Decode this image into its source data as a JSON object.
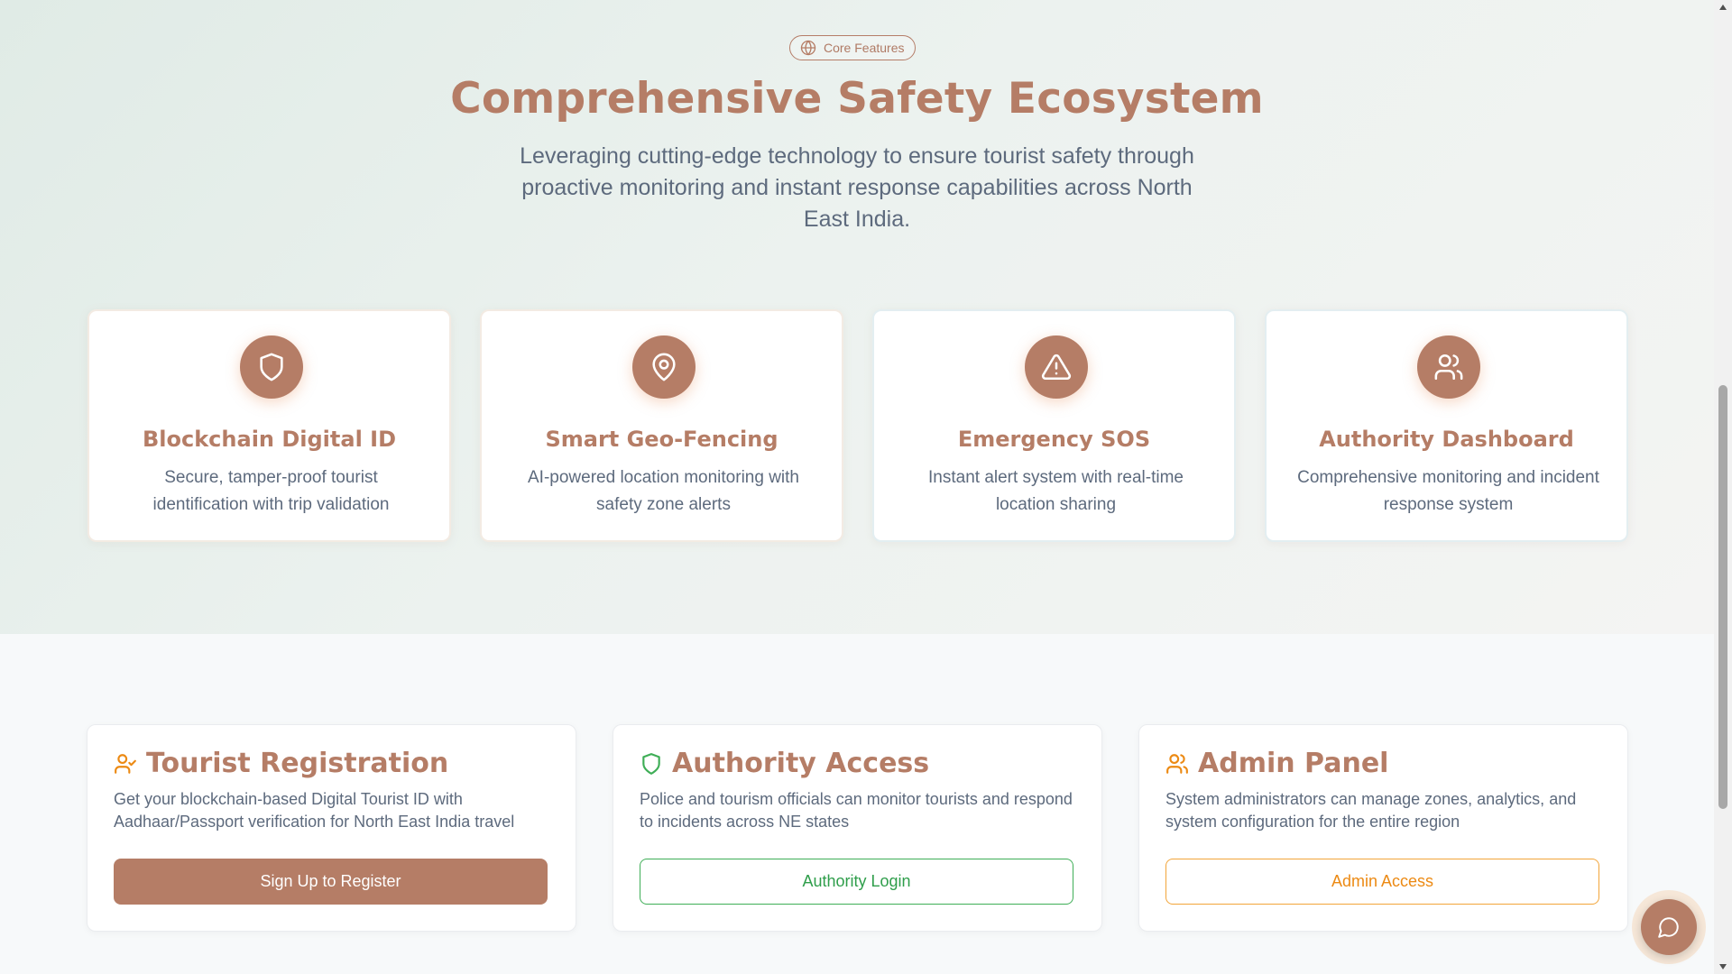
{
  "colors": {
    "brand": "#b57d66",
    "text": "#5d6a7d",
    "green": "#3fae57",
    "orange": "#ec8a14"
  },
  "features_section": {
    "badge": {
      "icon": "globe-icon",
      "label": "Core Features"
    },
    "title": "Comprehensive Safety Ecosystem",
    "subtitle": "Leveraging cutting-edge technology to ensure tourist safety through proactive monitoring and instant response capabilities across North East India.",
    "cards": [
      {
        "icon": "shield-icon",
        "title": "Blockchain Digital ID",
        "description": "Secure, tamper-proof tourist identification with trip validation"
      },
      {
        "icon": "map-pin-icon",
        "title": "Smart Geo-Fencing",
        "description": "AI-powered location monitoring with safety zone alerts"
      },
      {
        "icon": "alert-triangle-icon",
        "title": "Emergency SOS",
        "description": "Instant alert system with real-time location sharing"
      },
      {
        "icon": "users-icon",
        "title": "Authority Dashboard",
        "description": "Comprehensive monitoring and incident response system"
      }
    ]
  },
  "access_section": {
    "cards": [
      {
        "icon": "user-check-icon",
        "title": "Tourist Registration",
        "description": "Get your blockchain-based Digital Tourist ID with Aadhaar/Passport verification for North East India travel",
        "button": "Sign Up to Register"
      },
      {
        "icon": "shield-icon",
        "title": "Authority Access",
        "description": "Police and tourism officials can monitor tourists and respond to incidents across NE states",
        "button": "Authority Login"
      },
      {
        "icon": "users-icon",
        "title": "Admin Panel",
        "description": "System administrators can manage zones, analytics, and system configuration for the entire region",
        "button": "Admin Access"
      }
    ]
  },
  "chat_button": {
    "icon": "chat-bubble-icon"
  }
}
